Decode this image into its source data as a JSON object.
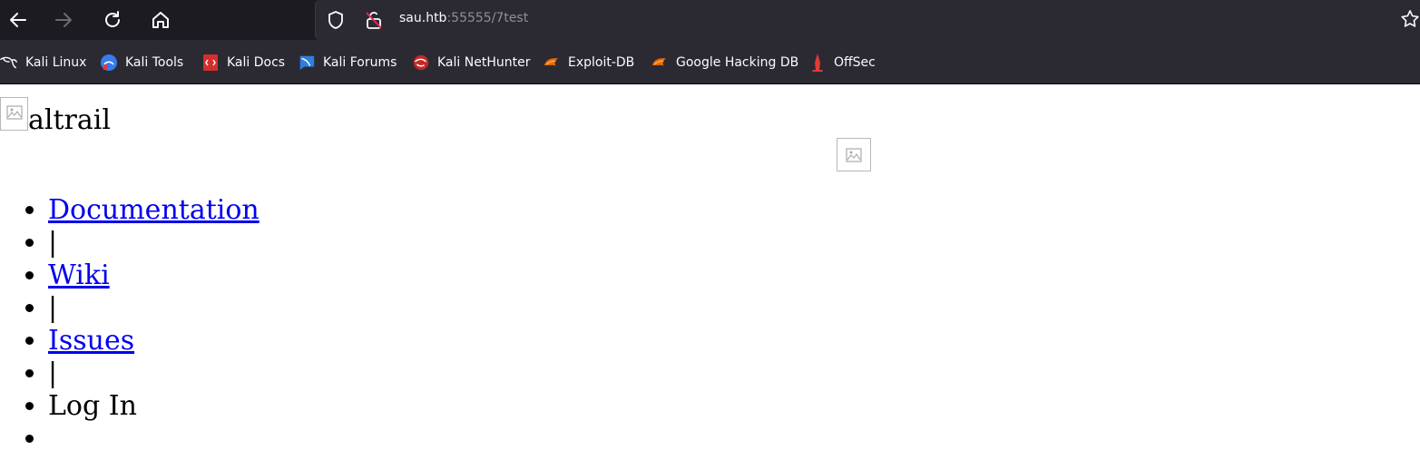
{
  "browser": {
    "url_host": "sau.htb",
    "url_rest": ":55555/7test",
    "icons": {
      "back": "arrow-left-icon",
      "forward": "arrow-right-icon",
      "reload": "reload-icon",
      "home": "home-icon",
      "tracking": "shield-icon",
      "insecure": "insecure-lock-icon",
      "bookmark": "star-icon"
    }
  },
  "bookmarks": [
    {
      "label": "Kali Linux",
      "icon": "kali-dragon-icon"
    },
    {
      "label": "Kali Tools",
      "icon": "kali-tools-icon"
    },
    {
      "label": "Kali Docs",
      "icon": "kali-docs-icon"
    },
    {
      "label": "Kali Forums",
      "icon": "kali-forums-icon"
    },
    {
      "label": "Kali NetHunter",
      "icon": "kali-nethunter-icon"
    },
    {
      "label": "Exploit-DB",
      "icon": "exploit-db-icon"
    },
    {
      "label": "Google Hacking DB",
      "icon": "ghdb-icon"
    },
    {
      "label": "OffSec",
      "icon": "offsec-icon"
    }
  ],
  "page": {
    "logo_text": "altrail",
    "menu": [
      {
        "label": "Documentation",
        "link": true
      },
      {
        "label": "|",
        "link": false
      },
      {
        "label": "Wiki",
        "link": true
      },
      {
        "label": "|",
        "link": false
      },
      {
        "label": "Issues",
        "link": true
      },
      {
        "label": "|",
        "link": false
      },
      {
        "label": "Log In",
        "link": false
      },
      {
        "label": "",
        "link": false
      }
    ]
  },
  "colors": {
    "chrome_bg": "#1c1b22",
    "urlbar_bg": "#2b2a33",
    "link": "#0000ee"
  }
}
